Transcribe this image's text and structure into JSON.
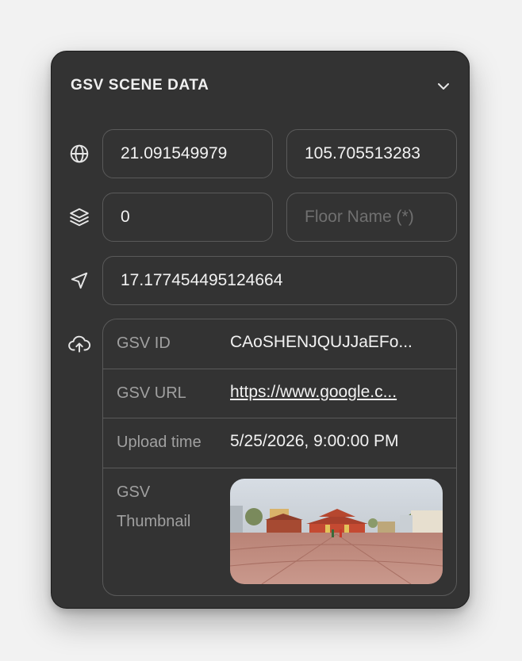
{
  "panel": {
    "title": "GSV SCENE DATA"
  },
  "location": {
    "icon": "globe-icon",
    "latitude": "21.091549979",
    "longitude": "105.705513283"
  },
  "floor": {
    "icon": "layers-icon",
    "level": "0",
    "name_placeholder": "Floor Name (*)"
  },
  "heading": {
    "icon": "navigation-arrow-icon",
    "value": "17.177454495124664"
  },
  "upload": {
    "icon": "cloud-upload-icon",
    "rows": [
      {
        "label": "GSV ID",
        "value": "CAoSHENJQUJJaEFo..."
      },
      {
        "label": "GSV URL",
        "value": "https://www.google.c..."
      },
      {
        "label": "Upload time",
        "value": "5/25/2026, 9:00:00 PM"
      }
    ],
    "thumbnail_label_line1": "GSV",
    "thumbnail_label_line2": "Thumbnail"
  },
  "colors": {
    "panel_bg": "#333333",
    "border": "#5a5a5a",
    "text": "#f2f2f2",
    "muted": "#a0a0a0"
  }
}
